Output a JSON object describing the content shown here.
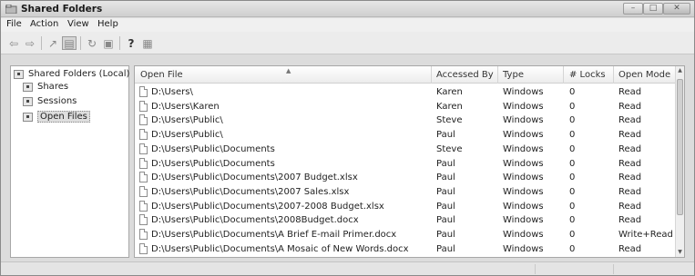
{
  "window": {
    "title": "Shared Folders",
    "icon": "shared-folders-icon",
    "buttons": {
      "minimize": "–",
      "maximize": "□",
      "close": "✕"
    }
  },
  "menu": [
    "File",
    "Action",
    "View",
    "Help"
  ],
  "toolbar": {
    "icons": [
      "back-arrow-icon",
      "forward-arrow-icon",
      "up-folder-icon",
      "show-hide-tree-icon",
      "refresh-icon",
      "export-list-icon",
      "help-icon",
      "properties-icon"
    ],
    "help_glyph": "?"
  },
  "tree": {
    "root": "Shared Folders (Local)",
    "children": [
      "Shares",
      "Sessions",
      "Open Files"
    ],
    "selected": "Open Files"
  },
  "list": {
    "columns": [
      "Open File",
      "Accessed By",
      "Type",
      "# Locks",
      "Open Mode"
    ],
    "rows": [
      [
        "D:\\Users\\",
        "Karen",
        "Windows",
        "0",
        "Read"
      ],
      [
        "D:\\Users\\Karen",
        "Karen",
        "Windows",
        "0",
        "Read"
      ],
      [
        "D:\\Users\\Public\\",
        "Steve",
        "Windows",
        "0",
        "Read"
      ],
      [
        "D:\\Users\\Public\\",
        "Paul",
        "Windows",
        "0",
        "Read"
      ],
      [
        "D:\\Users\\Public\\Documents",
        "Steve",
        "Windows",
        "0",
        "Read"
      ],
      [
        "D:\\Users\\Public\\Documents",
        "Paul",
        "Windows",
        "0",
        "Read"
      ],
      [
        "D:\\Users\\Public\\Documents\\2007 Budget.xlsx",
        "Paul",
        "Windows",
        "0",
        "Read"
      ],
      [
        "D:\\Users\\Public\\Documents\\2007 Sales.xlsx",
        "Paul",
        "Windows",
        "0",
        "Read"
      ],
      [
        "D:\\Users\\Public\\Documents\\2007-2008 Budget.xlsx",
        "Paul",
        "Windows",
        "0",
        "Read"
      ],
      [
        "D:\\Users\\Public\\Documents\\2008Budget.docx",
        "Paul",
        "Windows",
        "0",
        "Read"
      ],
      [
        "D:\\Users\\Public\\Documents\\A Brief E-mail Primer.docx",
        "Paul",
        "Windows",
        "0",
        "Write+Read"
      ],
      [
        "D:\\Users\\Public\\Documents\\A Mosaic of New Words.docx",
        "Paul",
        "Windows",
        "0",
        "Read"
      ]
    ]
  }
}
